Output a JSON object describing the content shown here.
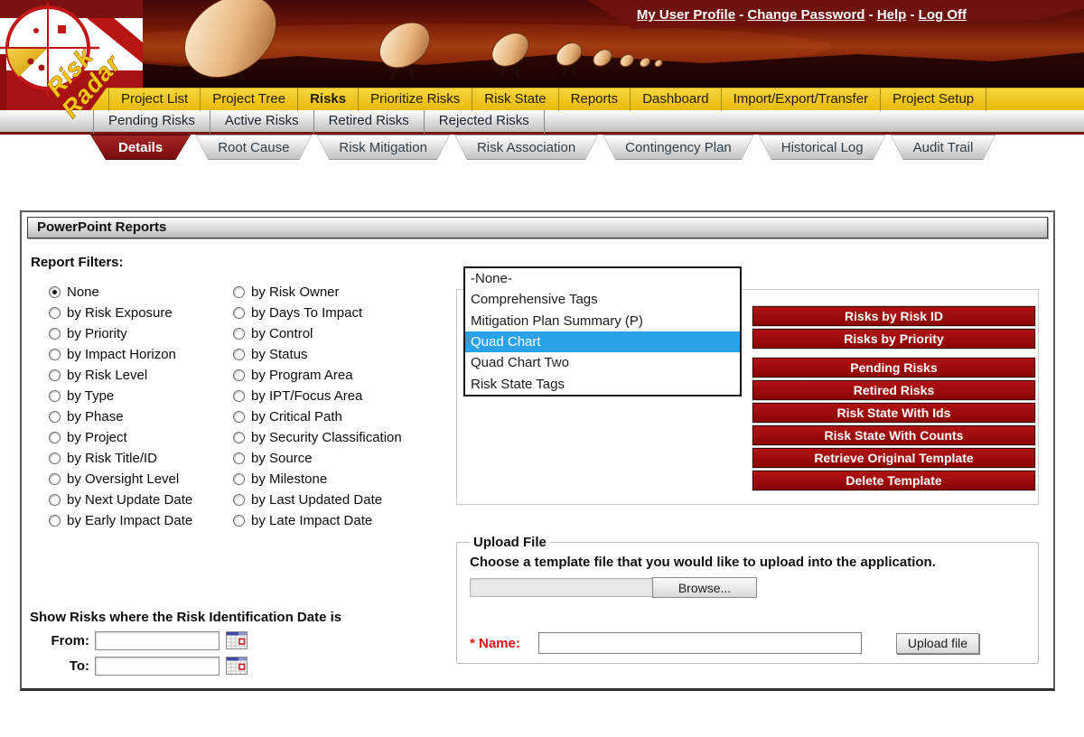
{
  "header": {
    "links": [
      "My User Profile",
      "Change Password",
      "Help",
      "Log Off"
    ],
    "separator": " - ",
    "logo": {
      "line1": "Risk",
      "line2": "Radar"
    }
  },
  "nav": {
    "items": [
      {
        "label": "Project List"
      },
      {
        "label": "Project Tree"
      },
      {
        "label": "Risks",
        "active": true
      },
      {
        "label": "Prioritize Risks"
      },
      {
        "label": "Risk State"
      },
      {
        "label": "Reports"
      },
      {
        "label": "Dashboard"
      },
      {
        "label": "Import/Export/Transfer"
      },
      {
        "label": "Project Setup"
      }
    ]
  },
  "subnav": {
    "items": [
      "Pending Risks",
      "Active Risks",
      "Retired Risks",
      "Rejected Risks"
    ]
  },
  "tabs": [
    {
      "label": "Details",
      "active": true
    },
    {
      "label": "Root Cause"
    },
    {
      "label": "Risk Mitigation"
    },
    {
      "label": "Risk Association"
    },
    {
      "label": "Contingency Plan"
    },
    {
      "label": "Historical Log"
    },
    {
      "label": "Audit Trail"
    }
  ],
  "panel": {
    "title": "PowerPoint Reports",
    "filters_label": "Report Filters:",
    "filters_col1": [
      {
        "label": "None",
        "selected": true
      },
      {
        "label": "by Risk Exposure"
      },
      {
        "label": "by Priority"
      },
      {
        "label": "by Impact Horizon"
      },
      {
        "label": "by Risk Level"
      },
      {
        "label": "by Type"
      },
      {
        "label": "by Phase"
      },
      {
        "label": "by Project"
      },
      {
        "label": "by Risk Title/ID"
      },
      {
        "label": "by Oversight Level"
      },
      {
        "label": "by Next Update Date"
      },
      {
        "label": "by Early Impact Date"
      }
    ],
    "filters_col2": [
      {
        "label": "by Risk Owner"
      },
      {
        "label": "by Days To Impact"
      },
      {
        "label": "by Control"
      },
      {
        "label": "by Status"
      },
      {
        "label": "by Program Area"
      },
      {
        "label": "by IPT/Focus Area"
      },
      {
        "label": "by Critical Path"
      },
      {
        "label": "by Security Classification"
      },
      {
        "label": "by Source"
      },
      {
        "label": "by Milestone"
      },
      {
        "label": "by Last Updated Date"
      },
      {
        "label": "by Late Impact Date"
      }
    ],
    "report_list": {
      "options": [
        {
          "label": "-None-"
        },
        {
          "label": "Comprehensive Tags"
        },
        {
          "label": "Mitigation Plan Summary (P)"
        },
        {
          "label": "Quad Chart",
          "selected": true
        },
        {
          "label": "Quad Chart Two"
        },
        {
          "label": "Risk State Tags"
        }
      ]
    },
    "action_buttons": [
      "Risks by Risk ID",
      "Risks by Priority",
      "Pending Risks",
      "Retired Risks",
      "Risk State With Ids",
      "Risk State With Counts",
      "Retrieve Original Template",
      "Delete Template"
    ],
    "upload": {
      "legend": "Upload File",
      "instruction": "Choose a template file that you would like to upload into the application.",
      "file_value": "",
      "browse_label": "Browse...",
      "name_label": "* Name:",
      "name_value": "",
      "upload_button": "Upload file"
    },
    "date_filter": {
      "heading": "Show Risks where the Risk Identification Date is",
      "from_label": "From:",
      "from_value": "",
      "to_label": "To:",
      "to_value": ""
    }
  },
  "colors": {
    "maroon": "#7d1414",
    "button_red": "#9c0a0b",
    "selection_blue": "#2ba2e8",
    "nav_yellow": "#eec115"
  }
}
